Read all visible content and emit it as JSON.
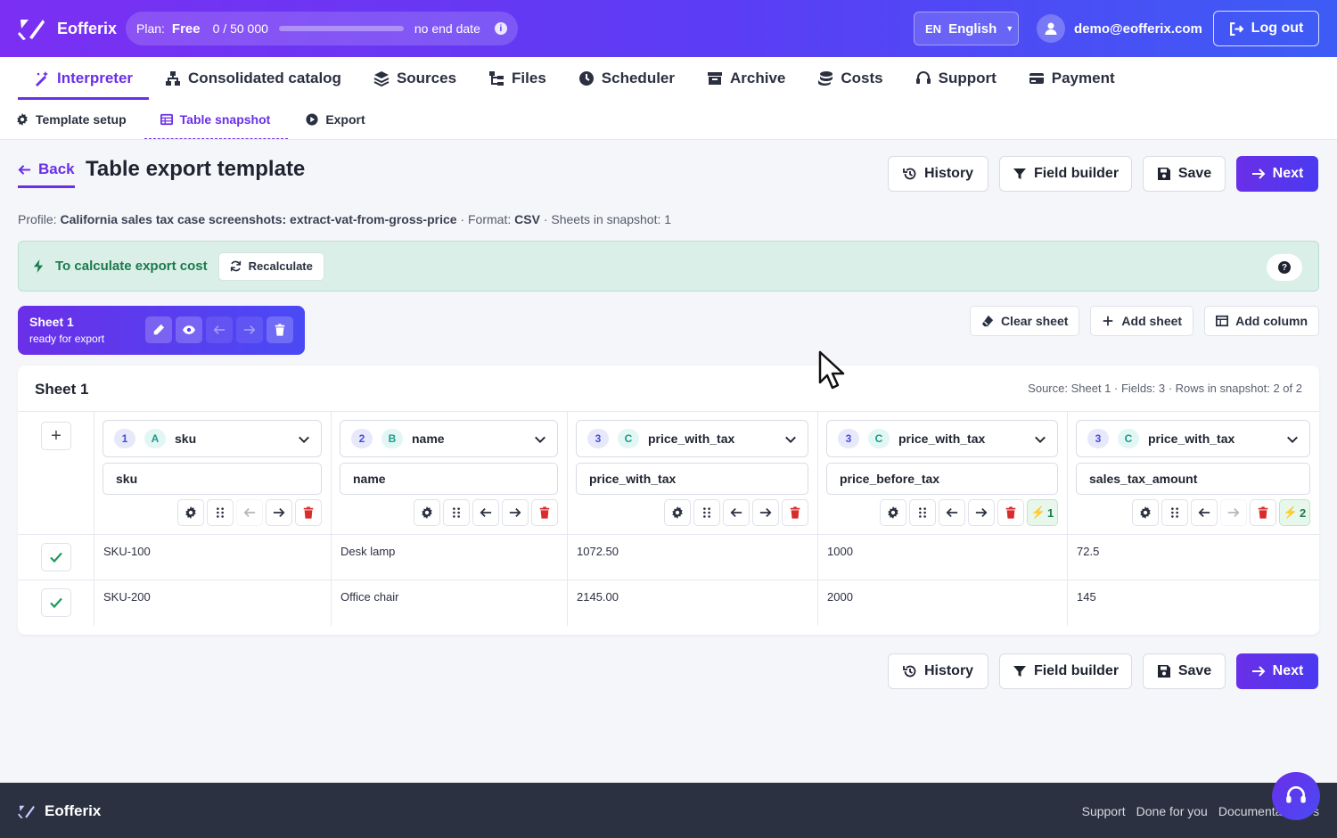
{
  "app": {
    "name": "Eofferix"
  },
  "plan": {
    "label": "Plan:",
    "name": "Free",
    "usage": "0 / 50 000",
    "progress": 0,
    "end": "no end date",
    "info": "i"
  },
  "lang": {
    "code": "EN",
    "name": "English"
  },
  "user": {
    "email": "demo@eofferix.com"
  },
  "logout_label": "Log out",
  "nav": [
    {
      "label": "Interpreter",
      "icon": "magic-wand-icon",
      "active": true
    },
    {
      "label": "Consolidated catalog",
      "icon": "network-icon"
    },
    {
      "label": "Sources",
      "icon": "layers-icon"
    },
    {
      "label": "Files",
      "icon": "folder-tree-icon"
    },
    {
      "label": "Scheduler",
      "icon": "clock-icon"
    },
    {
      "label": "Archive",
      "icon": "archive-icon"
    },
    {
      "label": "Costs",
      "icon": "coins-icon"
    },
    {
      "label": "Support",
      "icon": "headset-icon"
    },
    {
      "label": "Payment",
      "icon": "credit-card-icon"
    }
  ],
  "subnav": [
    {
      "label": "Template setup",
      "icon": "gear-icon"
    },
    {
      "label": "Table snapshot",
      "icon": "table-icon",
      "active": true
    },
    {
      "label": "Export",
      "icon": "play-circle-icon"
    }
  ],
  "page": {
    "back": "Back",
    "title": "Table export template",
    "profile_label": "Profile:",
    "profile_value": "California sales tax case screenshots: extract-vat-from-gross-price",
    "format_label": "Format:",
    "format_value": "CSV",
    "sheets_text": "Sheets in snapshot: 1"
  },
  "actions": {
    "history": "History",
    "field_builder": "Field builder",
    "save": "Save",
    "next": "Next"
  },
  "banner": {
    "text": "To calculate export cost",
    "recalc": "Recalculate",
    "help": "?"
  },
  "sheet_card": {
    "name": "Sheet 1",
    "status": "ready for export"
  },
  "tools": {
    "clear": "Clear sheet",
    "add_sheet": "Add sheet",
    "add_column": "Add column"
  },
  "table": {
    "title": "Sheet 1",
    "meta": "Source: Sheet 1 · Fields: 3 · Rows in snapshot: 2 of 2",
    "add": "+",
    "columns": [
      {
        "num": "1",
        "letter": "A",
        "field": "sku",
        "name": "sku",
        "badge": ""
      },
      {
        "num": "2",
        "letter": "B",
        "field": "name",
        "name": "name",
        "badge": ""
      },
      {
        "num": "3",
        "letter": "C",
        "field": "price_with_tax",
        "name": "price_with_tax",
        "badge": ""
      },
      {
        "num": "3",
        "letter": "C",
        "field": "price_with_tax",
        "name": "price_before_tax",
        "badge": "1"
      },
      {
        "num": "3",
        "letter": "C",
        "field": "price_with_tax",
        "name": "sales_tax_amount",
        "badge": "2"
      }
    ],
    "rows": [
      [
        "SKU-100",
        "Desk lamp",
        "1072.50",
        "1000",
        "72.5"
      ],
      [
        "SKU-200",
        "Office chair",
        "2145.00",
        "2000",
        "145"
      ]
    ]
  },
  "footer": {
    "name": "Eofferix",
    "links": [
      "Support",
      "Done for you",
      "Documentation",
      "s"
    ]
  },
  "colors": {
    "accent": "#6a2fe8",
    "success": "#1c7a4c",
    "danger": "#d92c2c"
  }
}
